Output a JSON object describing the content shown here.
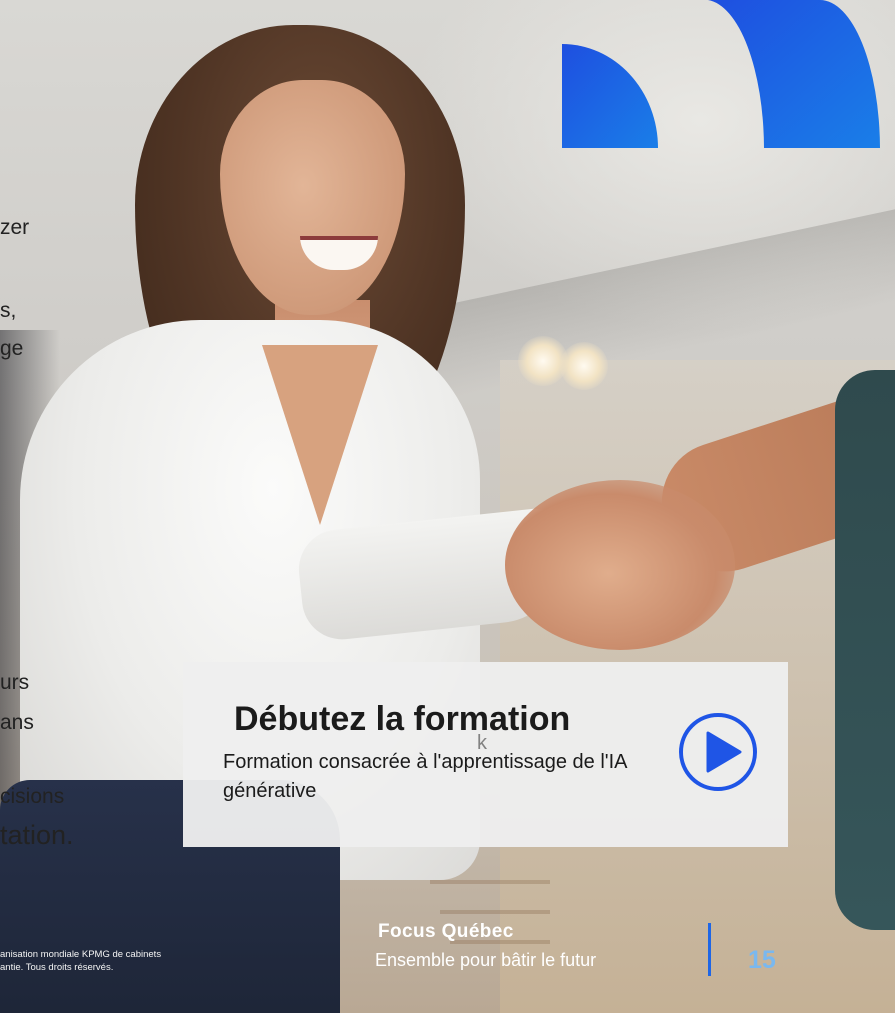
{
  "side_text": {
    "fragments": [
      "zer",
      "s,",
      "ge",
      "urs",
      "ans",
      "cisions",
      "tation."
    ]
  },
  "cta": {
    "title": "Débutez la formation",
    "subtitle": "Formation consacrée à l'apprentissage de l'IA générative",
    "play_icon": "play-circle-icon",
    "accent_color": "#1f55e6"
  },
  "footer": {
    "legal_line1": "anisation mondiale KPMG de cabinets",
    "legal_line2": "antie. Tous droits réservés.",
    "publication_title": "Focus Québec",
    "publication_subtitle": "Ensemble pour bâtir le futur",
    "page_number": "15",
    "divider_color": "#1e66e6",
    "page_number_color": "#79b8ef"
  },
  "decoration": {
    "shape_color_start": "#1e4fe0",
    "shape_color_end": "#1a7ee8"
  }
}
